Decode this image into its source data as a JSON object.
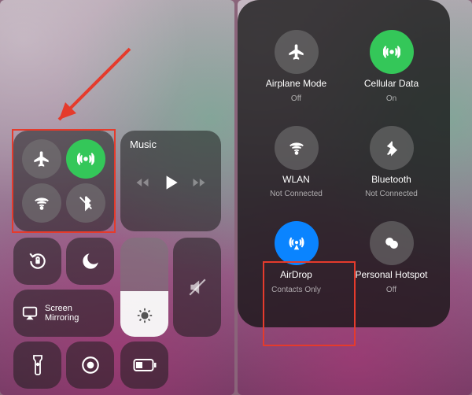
{
  "left": {
    "music_label": "Music",
    "screen_mirroring_label": "Screen\nMirroring"
  },
  "right": {
    "airplane": {
      "label": "Airplane Mode",
      "status": "Off"
    },
    "cellular": {
      "label": "Cellular Data",
      "status": "On"
    },
    "wlan": {
      "label": "WLAN",
      "status": "Not Connected"
    },
    "bluetooth": {
      "label": "Bluetooth",
      "status": "Not Connected"
    },
    "airdrop": {
      "label": "AirDrop",
      "status": "Contacts Only"
    },
    "hotspot": {
      "label": "Personal Hotspot",
      "status": "Off"
    }
  }
}
